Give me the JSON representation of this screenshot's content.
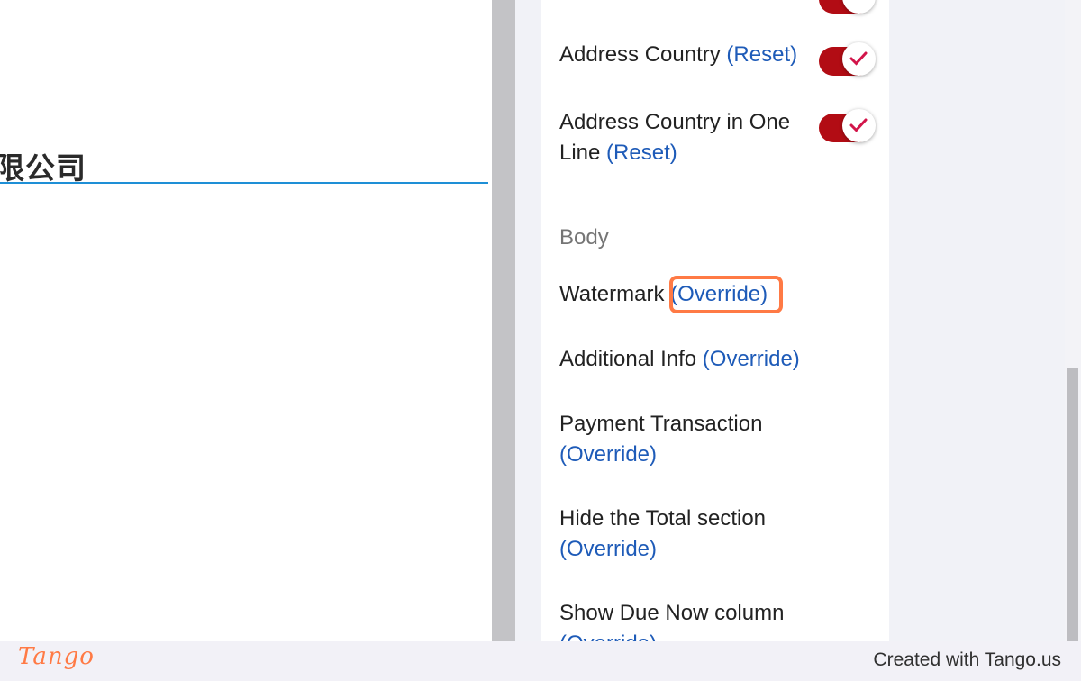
{
  "preview": {
    "title_fragment": "限公司"
  },
  "settings": {
    "rows": [
      {
        "label": "Address Country",
        "action": "(Reset)",
        "toggle_on": true
      },
      {
        "label_line1": "Address Country in One",
        "label_line2": "Line",
        "action": "(Reset)",
        "toggle_on": true
      }
    ],
    "section_body": "Body",
    "body_rows": [
      {
        "label": "Watermark",
        "action": "(Override)"
      },
      {
        "label": "Additional Info",
        "action": "(Override)"
      },
      {
        "label": "Payment Transaction",
        "action": "(Override)"
      },
      {
        "label": "Hide the Total section",
        "action": "(Override)"
      },
      {
        "label": "Show Due Now column",
        "action": "(Override)"
      }
    ]
  },
  "footer": {
    "logo": "Tango",
    "credit": "Created with Tango.us"
  },
  "colors": {
    "toggle_on": "#b20c14",
    "link": "#1e5bb8",
    "highlight": "#ff7a45",
    "underline": "#1e8fd6"
  }
}
